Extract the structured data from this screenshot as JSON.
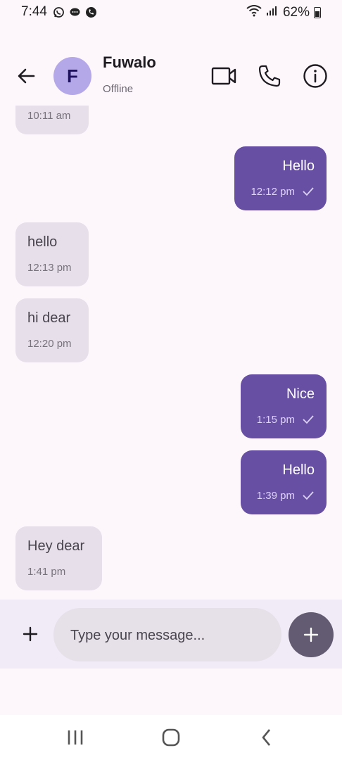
{
  "status_bar": {
    "time": "7:44",
    "battery": "62%"
  },
  "header": {
    "avatar_letter": "F",
    "name": "Fuwalo",
    "status": "Offline"
  },
  "messages": [
    {
      "direction": "in",
      "text": "",
      "time": "10:11 am"
    },
    {
      "direction": "out",
      "text": "Hello",
      "time": "12:12 pm",
      "read": true
    },
    {
      "direction": "in",
      "text": "hello",
      "time": "12:13 pm"
    },
    {
      "direction": "in",
      "text": "hi dear",
      "time": "12:20 pm"
    },
    {
      "direction": "out",
      "text": "Nice",
      "time": "1:15 pm",
      "read": true
    },
    {
      "direction": "out",
      "text": "Hello",
      "time": "1:39 pm",
      "read": true
    },
    {
      "direction": "in",
      "text": "Hey dear",
      "time": "1:41 pm"
    }
  ],
  "composer": {
    "placeholder": "Type your message..."
  },
  "colors": {
    "outgoing": "#6750a4",
    "incoming": "#e7e0eb",
    "send_button": "#625b71",
    "avatar": "#b5a8e8"
  },
  "icons": {
    "header": [
      "back-arrow-icon",
      "video-call-icon",
      "phone-icon",
      "info-icon"
    ],
    "composer": [
      "plus-icon",
      "send-plus-icon"
    ],
    "navigation": [
      "recents-icon",
      "home-icon",
      "back-icon"
    ]
  }
}
